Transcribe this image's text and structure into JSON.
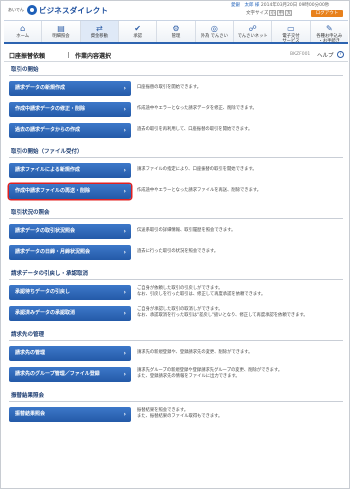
{
  "header": {
    "bank_prefix": "あいでん",
    "bank_name": "ビジネスダイレクト",
    "user_name": "愛銀　太郎 様",
    "last_login": "2014年03月20日 09時00分00秒",
    "font_size_label": "文字サイズ",
    "font_sizes": [
      "小",
      "中",
      "大"
    ],
    "logout_label": "ログアウト"
  },
  "gnav": [
    {
      "label": "ホーム",
      "icon": "home-icon",
      "glyph": "⌂"
    },
    {
      "label": "明細照会",
      "icon": "document-icon",
      "glyph": "▤"
    },
    {
      "label": "資金移動",
      "icon": "transfer-icon",
      "glyph": "⇄"
    },
    {
      "label": "承認",
      "icon": "approve-icon",
      "glyph": "✔"
    },
    {
      "label": "管理",
      "icon": "gear-icon",
      "glyph": "⚙"
    },
    {
      "label": "外為 でんさい",
      "icon": "globe-icon",
      "glyph": "◎"
    },
    {
      "label": "でんさいネット",
      "icon": "network-icon",
      "glyph": "☍"
    },
    {
      "label": "電子交付\nサービス",
      "icon": "monitor-icon",
      "glyph": "▭"
    },
    {
      "label": "各種お申込み\n・お手続き",
      "icon": "form-icon",
      "glyph": "✎"
    }
  ],
  "titlebar": {
    "crumb": "口座振替依頼",
    "page": "作業内容選択",
    "code": "BKZF001",
    "help": "ヘルプ",
    "help_icon": "?"
  },
  "sections": [
    {
      "title": "取引の開始",
      "rows": [
        {
          "label": "請求データの新規作成",
          "desc": "口座振替の取引を開始できます。"
        },
        {
          "label": "作成中請求データの修正・削除",
          "desc": "作成途中やエラーとなった請求データを修正、削除できます。"
        },
        {
          "label": "過去の請求データからの作成",
          "desc": "過去の取引を再利用して、口座振替の取引を開始できます。"
        }
      ]
    },
    {
      "title": "取引の開始（ファイル受付）",
      "rows": [
        {
          "label": "請求ファイルによる新規作成",
          "desc": "請求ファイルの指定により、口座振替の取引を開始できます。"
        },
        {
          "label": "作成中請求ファイルの再送・削除",
          "desc": "作成途中やエラーとなった請求ファイルを再送、削除できます。",
          "highlight": true
        }
      ]
    },
    {
      "title": "取引状況の照会",
      "rows": [
        {
          "label": "請求データの取引状況照会",
          "desc": "伝送系取引の詳細情報、取引履歴を照会できます。"
        },
        {
          "label": "請求データの日締・月締状況照会",
          "desc": "過去に行った取引の状況を照会できます。"
        }
      ]
    },
    {
      "title": "請求データの引戻し・承認取消",
      "rows": [
        {
          "label": "承認待ちデータの引戻し",
          "desc": "ご自身が依頼した取引の引戻しができます。\nなお、引戻しを行った取引は、修正して再度承認を依頼できます。"
        },
        {
          "label": "承認済みデータの承認取消",
          "desc": "ご自身が承認した取引の取消しができます。\nなお、承認取消を行った取引は\"差戻し\"扱いとなり、修正して再度承認を依頼できます。"
        }
      ]
    },
    {
      "title": "請求先の管理",
      "rows": [
        {
          "label": "請求先の管理",
          "desc": "請求先の新規登録や、登録請求先の変更、削除ができます。"
        },
        {
          "label": "請求先のグループ管理／ファイル登録",
          "desc": "請求先グループの新規登録や登録請求先グループの変更、削除ができます。\nまた、登録請求先の情報をファイルに出力できます。"
        }
      ]
    },
    {
      "title": "振替結果照会",
      "rows": [
        {
          "label": "振替結果照会",
          "desc": "振替結果を照会できます。\nまた、振替結果のファイル取得もできます。"
        }
      ]
    }
  ],
  "colors": {
    "accent": "#245aa8",
    "highlight": "#e02020",
    "logout": "#e8811c"
  }
}
